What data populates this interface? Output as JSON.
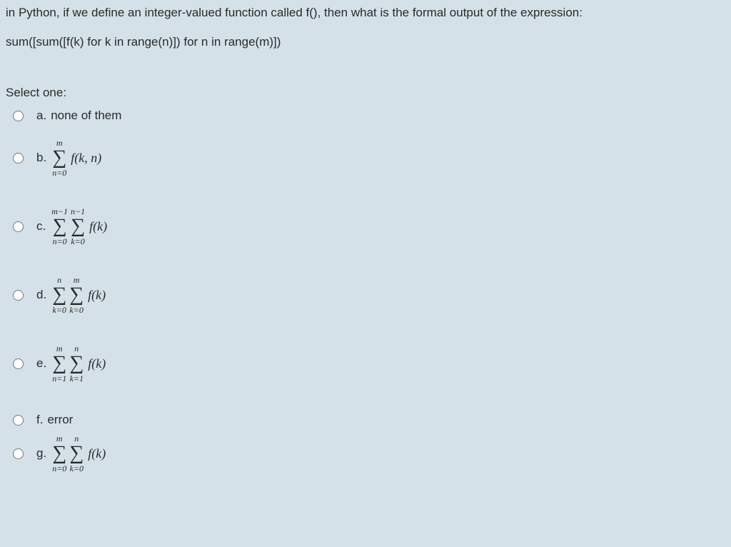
{
  "question": {
    "line1": "in Python, if we define an integer-valued function called f(), then what is the formal output of the expression:",
    "line2": "sum([sum([f(k) for k in range(n)]) for n in range(m)])"
  },
  "prompt": "Select one:",
  "options": {
    "a": {
      "letter": "a.",
      "text": "none of them"
    },
    "b": {
      "letter": "b.",
      "s1_top": "m",
      "s1_bot": "n=0",
      "fn": "f(k, n)"
    },
    "c": {
      "letter": "c.",
      "s1_top": "m−1",
      "s1_bot": "n=0",
      "s2_top": "n−1",
      "s2_bot": "k=0",
      "fn": "f(k)"
    },
    "d": {
      "letter": "d.",
      "s1_top": "n",
      "s1_bot": "k=0",
      "s2_top": "m",
      "s2_bot": "k=0",
      "fn": "f(k)"
    },
    "e": {
      "letter": "e.",
      "s1_top": "m",
      "s1_bot": "n=1",
      "s2_top": "n",
      "s2_bot": "k=1",
      "fn": "f(k)"
    },
    "f": {
      "letter": "f.",
      "text": "error"
    },
    "g": {
      "letter": "g.",
      "s1_top": "m",
      "s1_bot": "n=0",
      "s2_top": "n",
      "s2_bot": "k=0",
      "fn": "f(k)"
    }
  }
}
